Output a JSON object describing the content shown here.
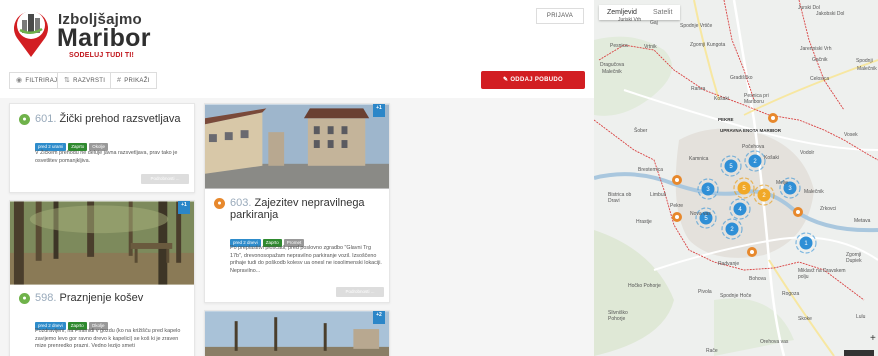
{
  "header": {
    "logo": {
      "line1": "Izboljšajmo",
      "line2": "Maribor",
      "tagline": "SODELUJ TUDI TI!"
    },
    "login_label": "PRIJAVA"
  },
  "toolbar": {
    "filter_label": "FILTRIRAJ",
    "sort_label": "RAZVRSTI",
    "show_label": "PRIKAŽI",
    "submit_label": "ODDAJ POBUDO"
  },
  "cards": [
    {
      "number": "601.",
      "title": "Žički prehod razsvetljava",
      "tags": [
        "pred 2 urami",
        "Zaprto",
        "Okolje"
      ],
      "description": "V Žičkem prehodu ne deluje javna razsvetljava, prav tako je osvetlitev pomanjkljiva.",
      "more_label": "Podrobnosti ..."
    },
    {
      "number": "598.",
      "title": "Praznjenje košev",
      "badge": "+1",
      "tags": [
        "pred 2 dnevi",
        "Zaprto",
        "Okolje"
      ],
      "description": "Pozdravljeni, na Piramidi v gozdu (ko na križišču pred kapelo zavijemo levo gor ravno drevo k kapelici) se koš ki je zraven mize prenredko prazni. Vedno lezijo smeti"
    },
    {
      "number": "603.",
      "title": "Zajezitev nepravilnega parkiranja",
      "badge": "+1",
      "tags": [
        "pred 2 dnevi",
        "Zaprto",
        "Promet"
      ],
      "description": "Po preplastitvi ploščadi, pred poslovno zgradbo \"Glavni Trg 17b\", drevonosopažam nepravilno parkiranje vozil. Izsoščeno prihaje tudi do poškodb kolesv ua onesl ne iosolimenski lokaciji. Nepravilno...",
      "more_label": "Podrobnosti ..."
    },
    {
      "badge": "+2"
    }
  ],
  "map": {
    "tab_map": "Zemljevid",
    "tab_satellite": "Satelit",
    "labels": [
      "Juriski Vrh",
      "Gaj",
      "Spodnje Vrtiče",
      "Jurski Dol",
      "Jakobski Dol",
      "Pesnica",
      "Vrtnik",
      "Zgornji Kungota",
      "Jarenniski Vrh",
      "Gačnik",
      "Spodnji",
      "Malečnik",
      "Dragučova",
      "Malečnik",
      "Gradiščko",
      "Ranca",
      "Celosica",
      "Pesnica pri Mariboru",
      "Košaki",
      "PEKRE",
      "UPRAVNA ENOTA MARIBOR",
      "Šober",
      "Vosek",
      "Počehova",
      "Brestemica",
      "Kamnica",
      "Košaki",
      "Vodolr",
      "Limbuš",
      "Melje",
      "Malečnik",
      "Bistrica ob Dravi",
      "Nova vas",
      "Hrastje",
      "Pekre",
      "Zrkovci",
      "Metava",
      "Radvanje",
      "Bohova",
      "Miklavž na Dravskem polju",
      "Zgornji Dupiek",
      "Hočko Pohorje",
      "Pivola",
      "Spodnje Hoče",
      "Rogoza",
      "Slivniško Pohorje",
      "Skoke",
      "Orehova vas",
      "Rače",
      "Lulu"
    ],
    "clusters": [
      5,
      2,
      3,
      5,
      2,
      3,
      4,
      5,
      2,
      1,
      3
    ]
  }
}
